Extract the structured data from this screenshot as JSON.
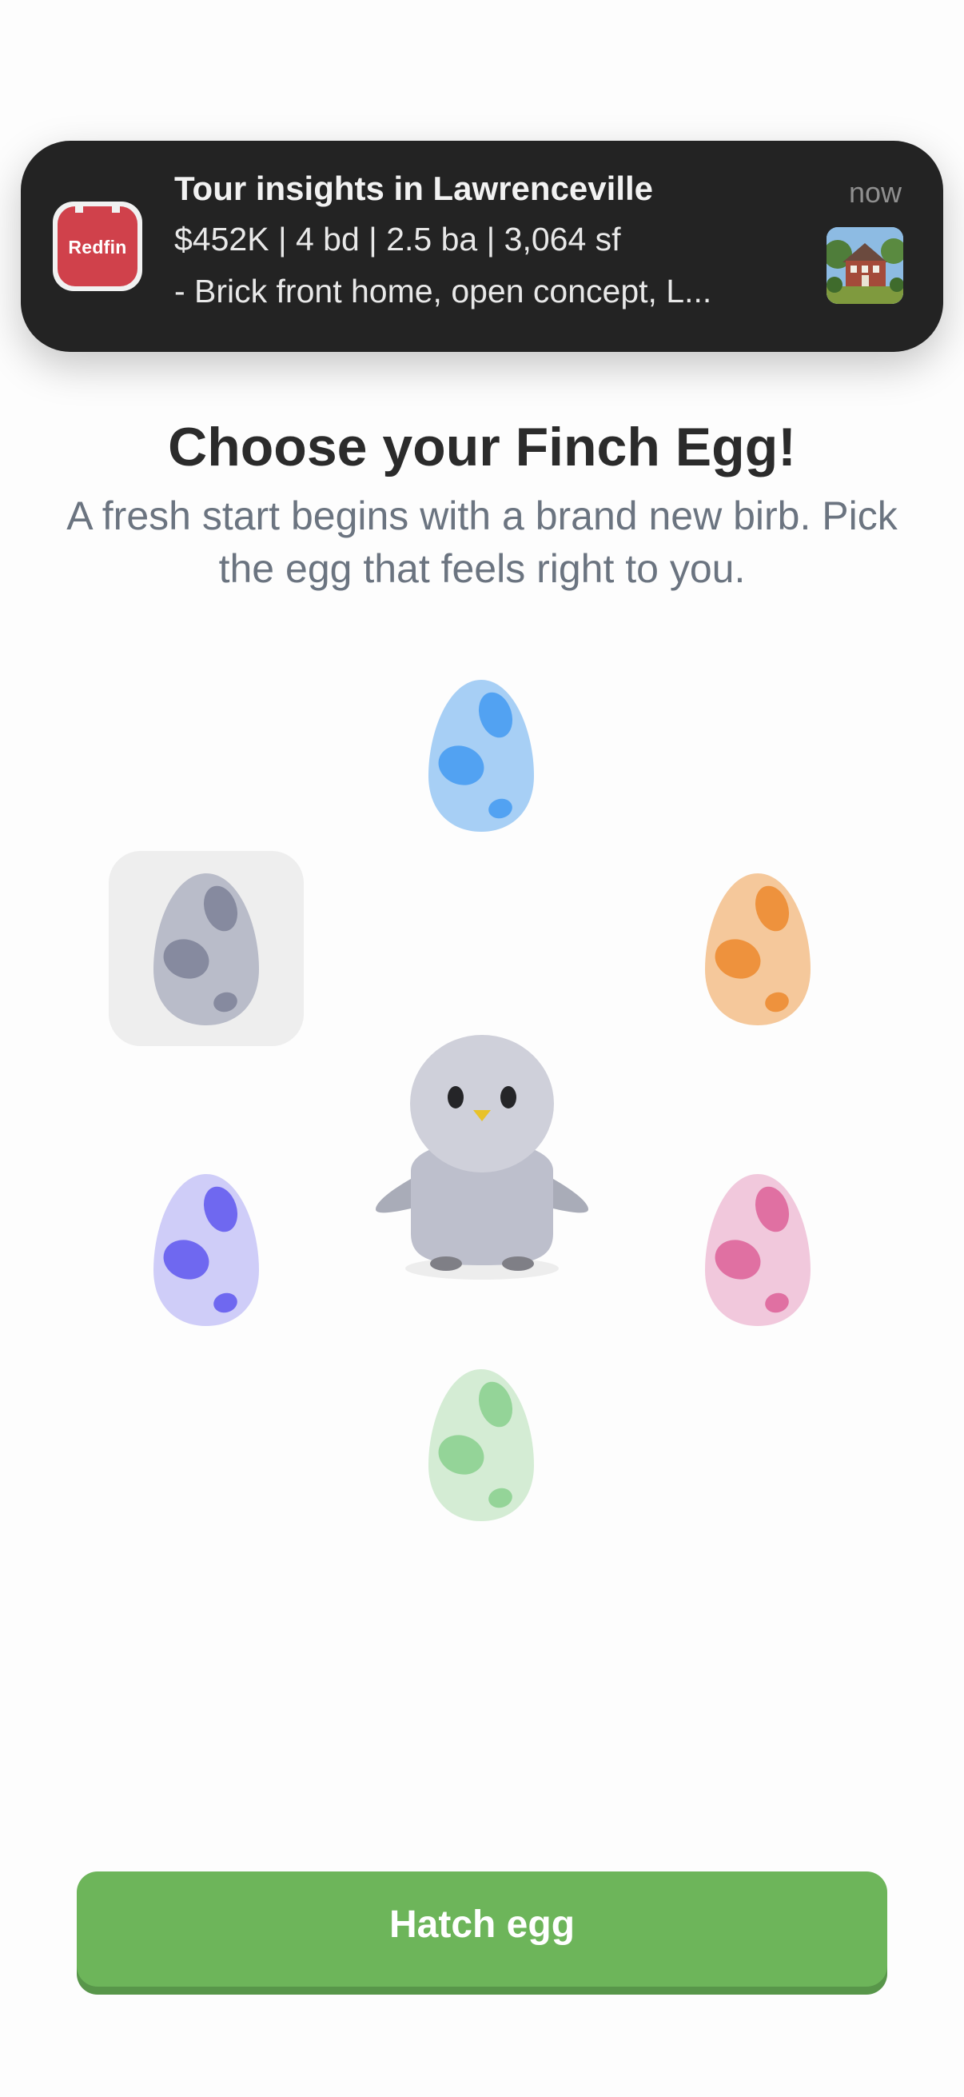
{
  "notification": {
    "app_name": "Redfin",
    "title": "Tour insights in Lawrenceville",
    "line1": "$452K | 4 bd | 2.5 ba | 3,064 sf",
    "line2": "- Brick front home, open concept, L...",
    "time": "now"
  },
  "page": {
    "title": "Choose your Finch Egg!",
    "subtitle": "A fresh start begins with a brand new birb. Pick the egg that feels right to you."
  },
  "eggs": [
    {
      "name": "blue",
      "shell": "#a7cff5",
      "spots": "#52a2f2",
      "selected": false
    },
    {
      "name": "gray",
      "shell": "#b9bcc9",
      "spots": "#868a9f",
      "selected": true
    },
    {
      "name": "orange",
      "shell": "#f5c89b",
      "spots": "#ee923d",
      "selected": false
    },
    {
      "name": "purple",
      "shell": "#cfcdf8",
      "spots": "#6f68f0",
      "selected": false
    },
    {
      "name": "pink",
      "shell": "#f1c8dc",
      "spots": "#e070a2",
      "selected": false
    },
    {
      "name": "green",
      "shell": "#d4ecd4",
      "spots": "#94d498",
      "selected": false
    }
  ],
  "actions": {
    "hatch_label": "Hatch egg"
  },
  "colors": {
    "button": "#6db55a",
    "notification_bg": "#232323",
    "redfin_brand": "#d0414b"
  }
}
